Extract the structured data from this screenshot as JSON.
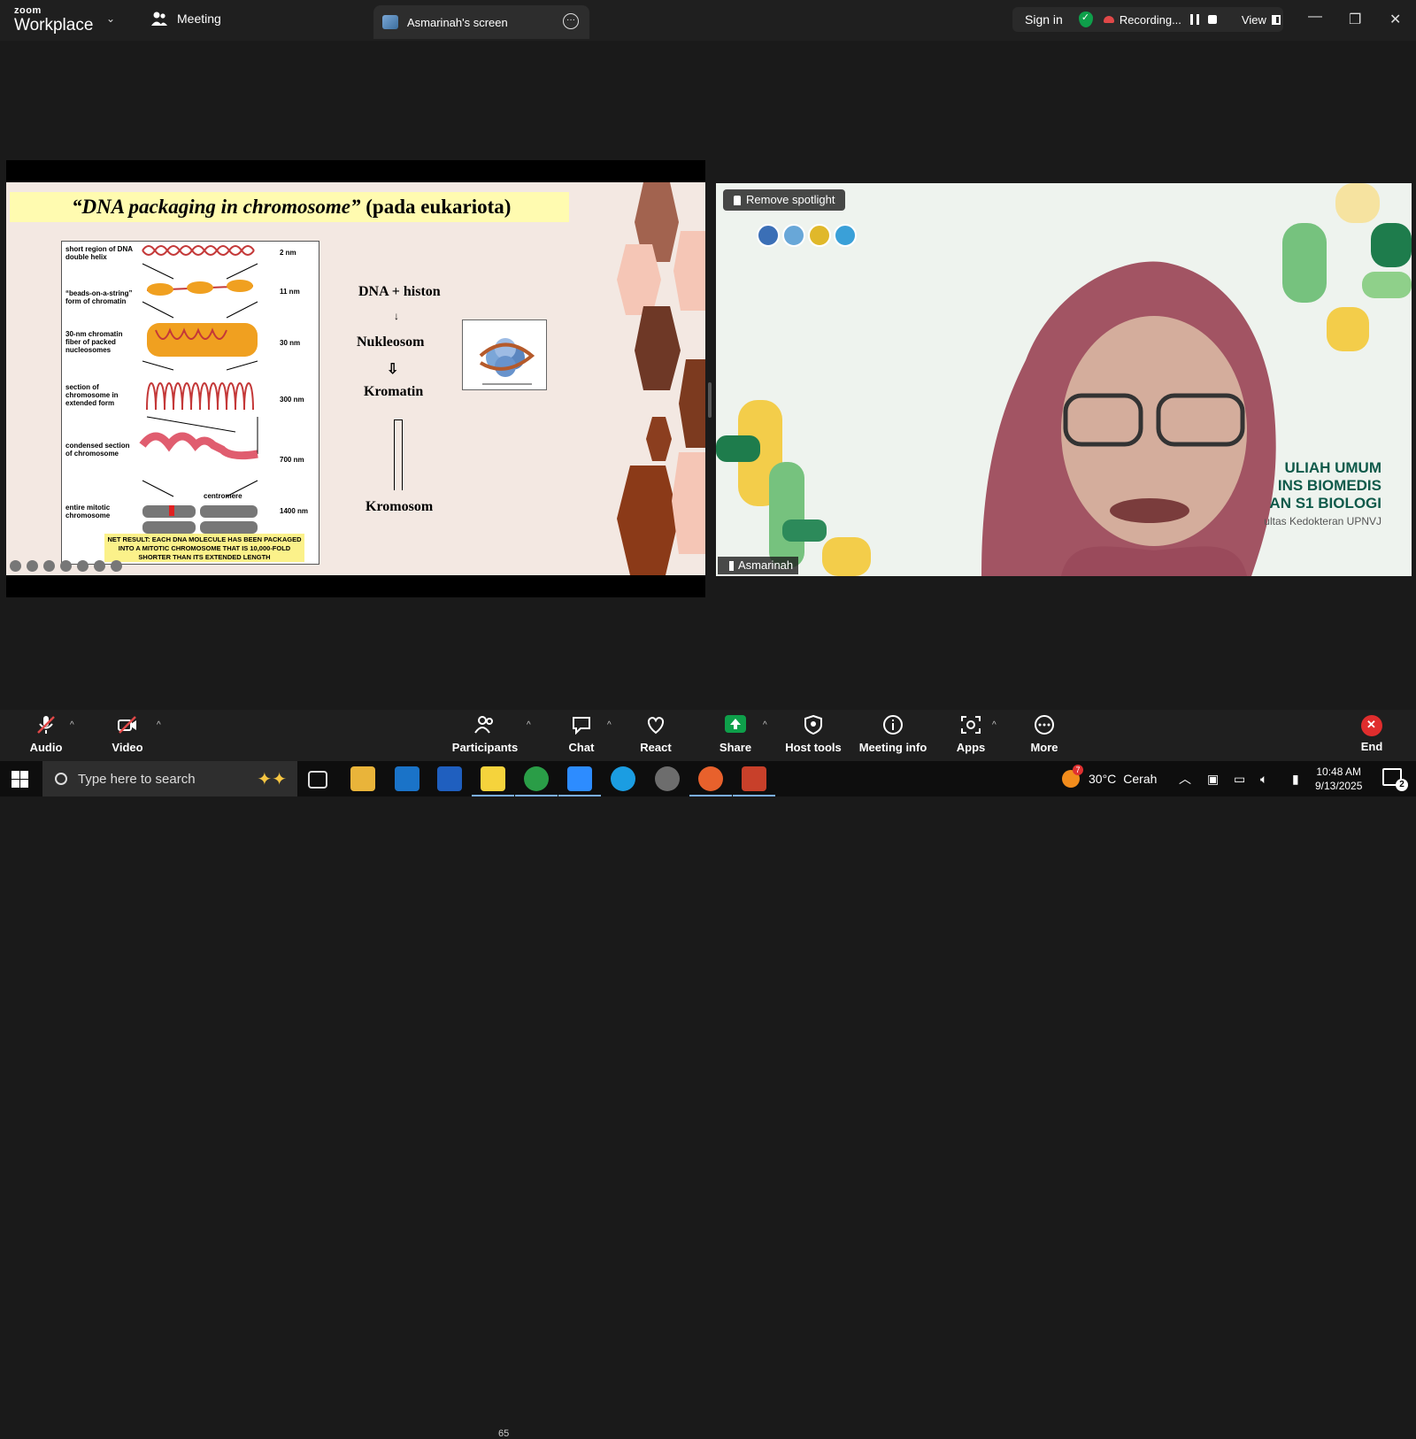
{
  "app": {
    "logo_top": "zoom",
    "logo_bottom": "Workplace"
  },
  "tabs": [
    {
      "label": "Meeting"
    },
    {
      "label": "Asmarinah's screen"
    }
  ],
  "header": {
    "sign_in": "Sign in",
    "recording": "Recording...",
    "view": "View"
  },
  "slide": {
    "title_italic": "“DNA packaging in chromosome”",
    "title_rest": " (pada eukariota)",
    "figure": {
      "labels": [
        "short region of DNA double helix",
        "“beads-on-a-string” form of chromatin",
        "30-nm chromatin fiber of packed nucleosomes",
        "section of chromosome in extended form",
        "condensed section of chromosome",
        "entire mitotic chromosome"
      ],
      "scales": [
        "2 nm",
        "11 nm",
        "30 nm",
        "300 nm",
        "700 nm",
        "1400 nm"
      ],
      "centromere": "centromere",
      "net_result": "NET RESULT: EACH DNA MOLECULE HAS BEEN PACKAGED INTO A MITOTIC CHROMOSOME THAT IS 10,000-FOLD SHORTER THAN ITS EXTENDED LENGTH"
    },
    "flow": [
      "DNA + histon",
      "Nukleosom",
      "Kromatin",
      "Kromosom"
    ]
  },
  "video": {
    "spotlight_button": "Remove spotlight",
    "participant_name": "Asmarinah",
    "banner_lines": [
      "ULIAH UMUM",
      "INS BIOMEDIS",
      "AN S1 BIOLOGI"
    ],
    "banner_sub": "ultas Kedokteran UPNVJ"
  },
  "toolbar": {
    "audio": "Audio",
    "video": "Video",
    "participants": "Participants",
    "participants_count": "65",
    "chat": "Chat",
    "react": "React",
    "share": "Share",
    "host_tools": "Host tools",
    "meeting_info": "Meeting info",
    "apps": "Apps",
    "more": "More",
    "end": "End"
  },
  "taskbar": {
    "search_placeholder": "Type here to search",
    "weather_temp": "30°C",
    "weather_text": "Cerah",
    "weather_badge": "7",
    "time": "10:48 AM",
    "date": "9/13/2025",
    "notifications": "2"
  },
  "colors": {
    "zoom_bg": "#1a1a1a",
    "share_green": "#0e9f4a",
    "end_red": "#e02d2d",
    "slide_title_bg": "#fffbb0",
    "banner_green": "#0f5a4a"
  }
}
